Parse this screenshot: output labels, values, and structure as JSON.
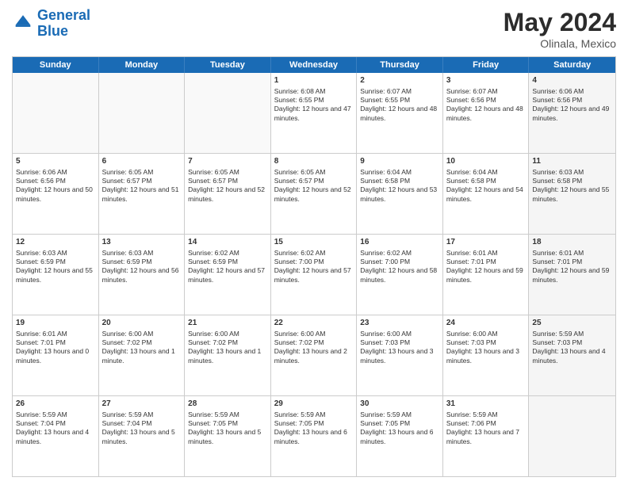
{
  "header": {
    "logo_line1": "General",
    "logo_line2": "Blue",
    "title": "May 2024",
    "location": "Olinala, Mexico"
  },
  "days_of_week": [
    "Sunday",
    "Monday",
    "Tuesday",
    "Wednesday",
    "Thursday",
    "Friday",
    "Saturday"
  ],
  "weeks": [
    [
      {
        "day": "",
        "info": "",
        "empty": true
      },
      {
        "day": "",
        "info": "",
        "empty": true
      },
      {
        "day": "",
        "info": "",
        "empty": true
      },
      {
        "day": "1",
        "info": "Sunrise: 6:08 AM\nSunset: 6:55 PM\nDaylight: 12 hours and 47 minutes.",
        "empty": false
      },
      {
        "day": "2",
        "info": "Sunrise: 6:07 AM\nSunset: 6:55 PM\nDaylight: 12 hours and 48 minutes.",
        "empty": false
      },
      {
        "day": "3",
        "info": "Sunrise: 6:07 AM\nSunset: 6:56 PM\nDaylight: 12 hours and 48 minutes.",
        "empty": false
      },
      {
        "day": "4",
        "info": "Sunrise: 6:06 AM\nSunset: 6:56 PM\nDaylight: 12 hours and 49 minutes.",
        "empty": false,
        "shaded": true
      }
    ],
    [
      {
        "day": "5",
        "info": "Sunrise: 6:06 AM\nSunset: 6:56 PM\nDaylight: 12 hours and 50 minutes.",
        "empty": false
      },
      {
        "day": "6",
        "info": "Sunrise: 6:05 AM\nSunset: 6:57 PM\nDaylight: 12 hours and 51 minutes.",
        "empty": false
      },
      {
        "day": "7",
        "info": "Sunrise: 6:05 AM\nSunset: 6:57 PM\nDaylight: 12 hours and 52 minutes.",
        "empty": false
      },
      {
        "day": "8",
        "info": "Sunrise: 6:05 AM\nSunset: 6:57 PM\nDaylight: 12 hours and 52 minutes.",
        "empty": false
      },
      {
        "day": "9",
        "info": "Sunrise: 6:04 AM\nSunset: 6:58 PM\nDaylight: 12 hours and 53 minutes.",
        "empty": false
      },
      {
        "day": "10",
        "info": "Sunrise: 6:04 AM\nSunset: 6:58 PM\nDaylight: 12 hours and 54 minutes.",
        "empty": false
      },
      {
        "day": "11",
        "info": "Sunrise: 6:03 AM\nSunset: 6:58 PM\nDaylight: 12 hours and 55 minutes.",
        "empty": false,
        "shaded": true
      }
    ],
    [
      {
        "day": "12",
        "info": "Sunrise: 6:03 AM\nSunset: 6:59 PM\nDaylight: 12 hours and 55 minutes.",
        "empty": false
      },
      {
        "day": "13",
        "info": "Sunrise: 6:03 AM\nSunset: 6:59 PM\nDaylight: 12 hours and 56 minutes.",
        "empty": false
      },
      {
        "day": "14",
        "info": "Sunrise: 6:02 AM\nSunset: 6:59 PM\nDaylight: 12 hours and 57 minutes.",
        "empty": false
      },
      {
        "day": "15",
        "info": "Sunrise: 6:02 AM\nSunset: 7:00 PM\nDaylight: 12 hours and 57 minutes.",
        "empty": false
      },
      {
        "day": "16",
        "info": "Sunrise: 6:02 AM\nSunset: 7:00 PM\nDaylight: 12 hours and 58 minutes.",
        "empty": false
      },
      {
        "day": "17",
        "info": "Sunrise: 6:01 AM\nSunset: 7:01 PM\nDaylight: 12 hours and 59 minutes.",
        "empty": false
      },
      {
        "day": "18",
        "info": "Sunrise: 6:01 AM\nSunset: 7:01 PM\nDaylight: 12 hours and 59 minutes.",
        "empty": false,
        "shaded": true
      }
    ],
    [
      {
        "day": "19",
        "info": "Sunrise: 6:01 AM\nSunset: 7:01 PM\nDaylight: 13 hours and 0 minutes.",
        "empty": false
      },
      {
        "day": "20",
        "info": "Sunrise: 6:00 AM\nSunset: 7:02 PM\nDaylight: 13 hours and 1 minute.",
        "empty": false
      },
      {
        "day": "21",
        "info": "Sunrise: 6:00 AM\nSunset: 7:02 PM\nDaylight: 13 hours and 1 minutes.",
        "empty": false
      },
      {
        "day": "22",
        "info": "Sunrise: 6:00 AM\nSunset: 7:02 PM\nDaylight: 13 hours and 2 minutes.",
        "empty": false
      },
      {
        "day": "23",
        "info": "Sunrise: 6:00 AM\nSunset: 7:03 PM\nDaylight: 13 hours and 3 minutes.",
        "empty": false
      },
      {
        "day": "24",
        "info": "Sunrise: 6:00 AM\nSunset: 7:03 PM\nDaylight: 13 hours and 3 minutes.",
        "empty": false
      },
      {
        "day": "25",
        "info": "Sunrise: 5:59 AM\nSunset: 7:03 PM\nDaylight: 13 hours and 4 minutes.",
        "empty": false,
        "shaded": true
      }
    ],
    [
      {
        "day": "26",
        "info": "Sunrise: 5:59 AM\nSunset: 7:04 PM\nDaylight: 13 hours and 4 minutes.",
        "empty": false
      },
      {
        "day": "27",
        "info": "Sunrise: 5:59 AM\nSunset: 7:04 PM\nDaylight: 13 hours and 5 minutes.",
        "empty": false
      },
      {
        "day": "28",
        "info": "Sunrise: 5:59 AM\nSunset: 7:05 PM\nDaylight: 13 hours and 5 minutes.",
        "empty": false
      },
      {
        "day": "29",
        "info": "Sunrise: 5:59 AM\nSunset: 7:05 PM\nDaylight: 13 hours and 6 minutes.",
        "empty": false
      },
      {
        "day": "30",
        "info": "Sunrise: 5:59 AM\nSunset: 7:05 PM\nDaylight: 13 hours and 6 minutes.",
        "empty": false
      },
      {
        "day": "31",
        "info": "Sunrise: 5:59 AM\nSunset: 7:06 PM\nDaylight: 13 hours and 7 minutes.",
        "empty": false
      },
      {
        "day": "",
        "info": "",
        "empty": true,
        "shaded": true
      }
    ]
  ]
}
